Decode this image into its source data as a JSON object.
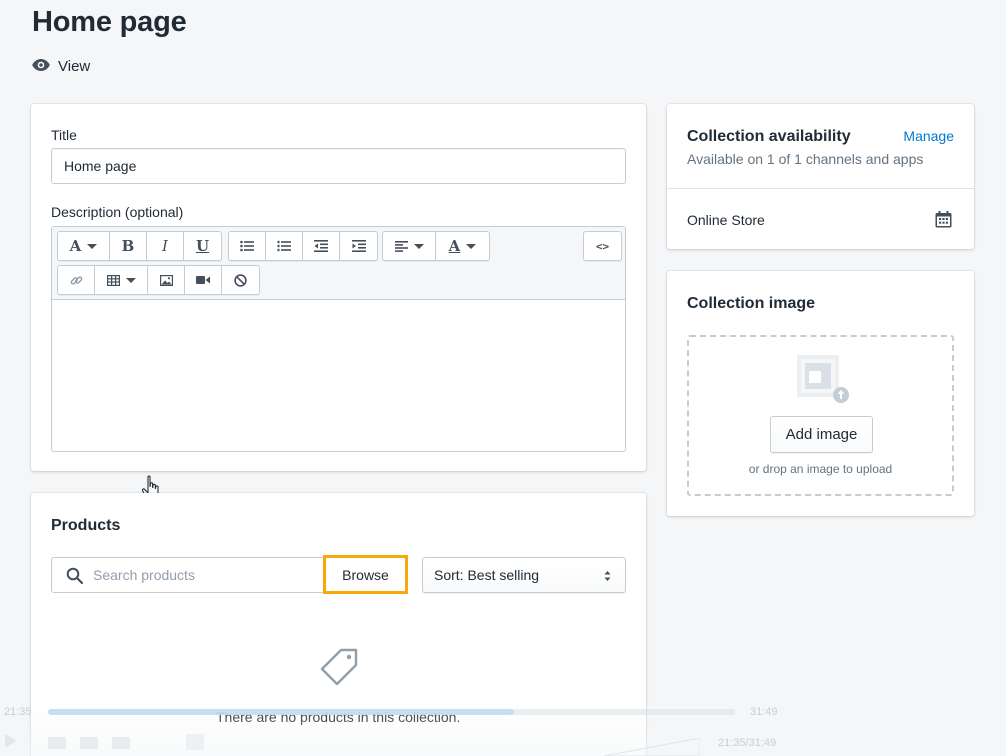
{
  "header": {
    "title": "Home page",
    "view_label": "View"
  },
  "main_card": {
    "title_label": "Title",
    "title_value": "Home page",
    "description_label": "Description (optional)",
    "toolbar": {
      "font_label": "A",
      "bold_label": "B",
      "italic_label": "I",
      "underline_label": "U",
      "code_label": "<>"
    }
  },
  "products": {
    "heading": "Products",
    "search_placeholder": "Search products",
    "browse_label": "Browse",
    "sort_label": "Sort: Best selling",
    "empty_text": "There are no products in this collection."
  },
  "availability": {
    "heading": "Collection availability",
    "manage_label": "Manage",
    "summary": "Available on 1 of 1 channels and apps",
    "channel": "Online Store"
  },
  "collection_image": {
    "heading": "Collection image",
    "add_label": "Add image",
    "drop_hint": "or drop an image to upload"
  },
  "player": {
    "elapsed": "21:35",
    "total": "31:49",
    "combined": "21:35/31:49",
    "progress_fraction": 0.678
  },
  "colors": {
    "link": "#007ace",
    "highlight": "#f5a90a",
    "background": "#f4f6f8",
    "border": "#c4cdd5"
  }
}
